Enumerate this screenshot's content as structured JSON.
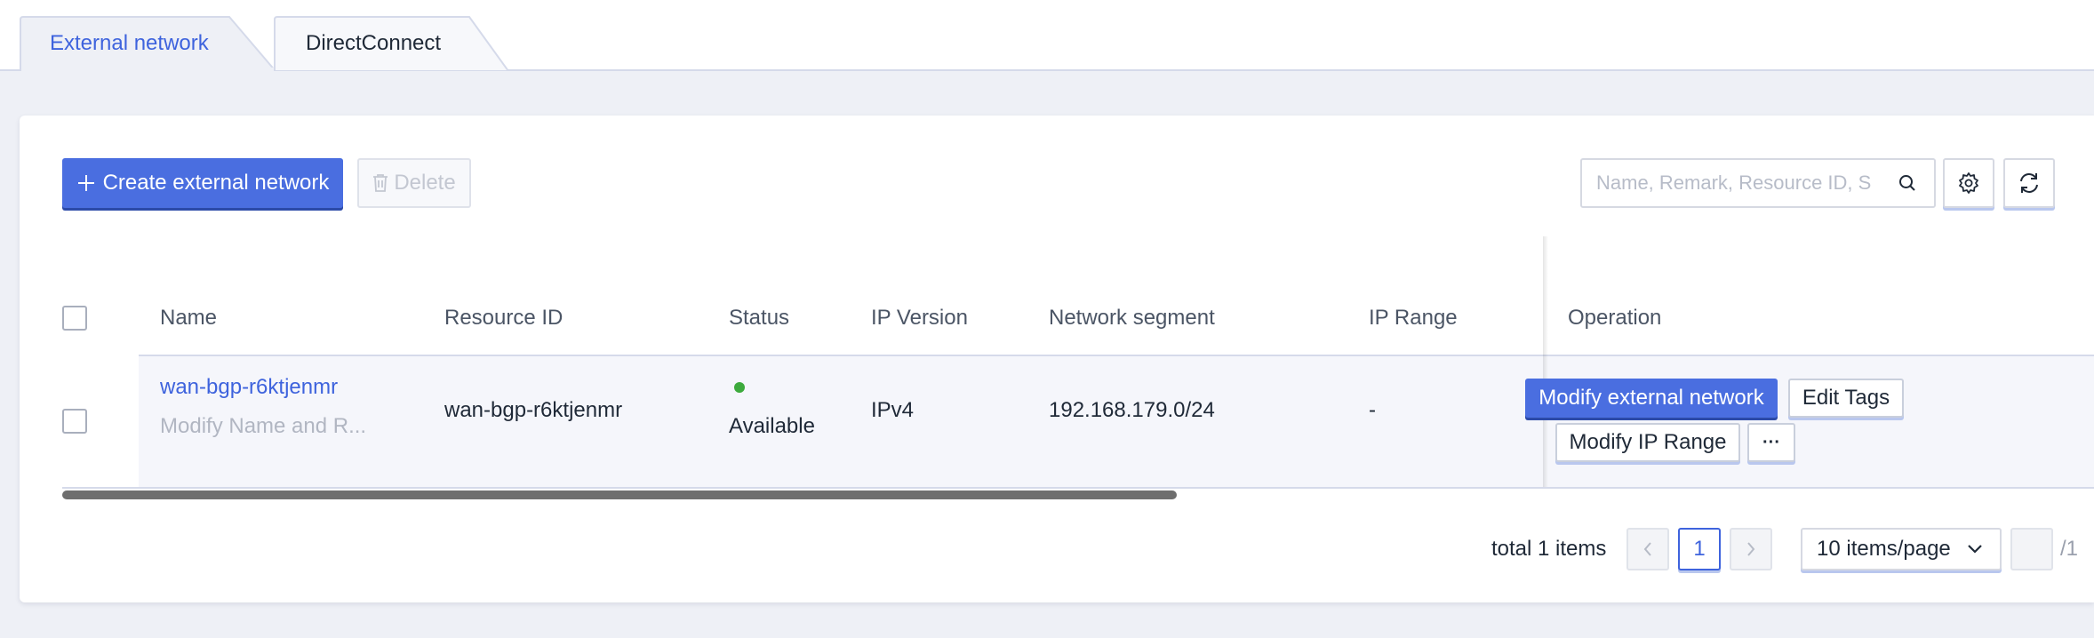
{
  "tabs": [
    {
      "label": "External network",
      "active": true
    },
    {
      "label": "DirectConnect",
      "active": false
    }
  ],
  "toolbar": {
    "create_label": "Create external network",
    "delete_label": "Delete",
    "search_placeholder": "Name, Remark, Resource ID, S",
    "settings_icon": "gear-icon",
    "refresh_icon": "refresh-icon"
  },
  "table": {
    "columns": [
      "Name",
      "Resource ID",
      "Status",
      "IP Version",
      "Network segment",
      "IP Range",
      "Operation"
    ],
    "rows": [
      {
        "name": "wan-bgp-r6ktjenmr",
        "remark": "Modify Name and R...",
        "resource_id": "wan-bgp-r6ktjenmr",
        "status": "Available",
        "ip_version": "IPv4",
        "network_segment": "192.168.179.0/24",
        "ip_range": "-",
        "operations": {
          "modify_network": "Modify external network",
          "edit_tags": "Edit Tags",
          "modify_ip_range": "Modify IP Range",
          "more": "···"
        }
      }
    ]
  },
  "pagination": {
    "total_text": "total 1 items",
    "current_page": "1",
    "page_size": "10 items/page",
    "total_pages": "/1"
  },
  "colors": {
    "accent": "#4a6ee0",
    "link": "#3e63dd",
    "status_available": "#3daa3d"
  }
}
